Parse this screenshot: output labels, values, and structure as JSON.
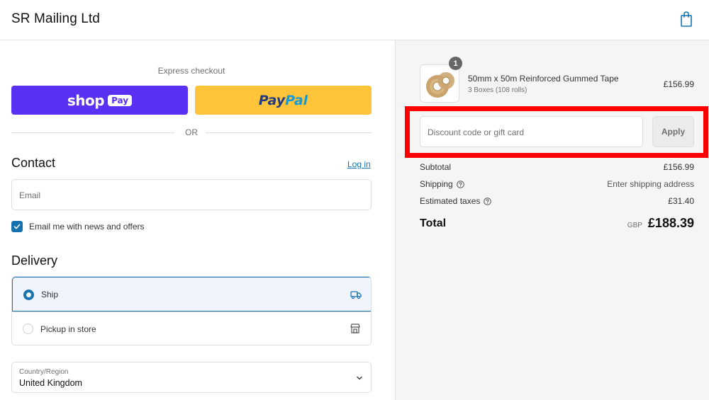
{
  "header": {
    "brand": "SR Mailing Ltd",
    "cart_icon": "shopping-bag-icon"
  },
  "express": {
    "label": "Express checkout",
    "shop_pay": {
      "word": "shop",
      "badge": "Pay",
      "color": "#5a31f4"
    },
    "paypal": {
      "part1": "Pay",
      "part2": "Pal",
      "color": "#ffc439"
    },
    "or_text": "OR"
  },
  "contact": {
    "title": "Contact",
    "login_label": "Log in",
    "email_placeholder": "Email",
    "news_checkbox_label": "Email me with news and offers",
    "news_checked": true
  },
  "delivery": {
    "title": "Delivery",
    "options": [
      {
        "label": "Ship",
        "selected": true,
        "icon": "truck-icon"
      },
      {
        "label": "Pickup in store",
        "selected": false,
        "icon": "store-icon"
      }
    ],
    "country_label": "Country/Region",
    "country_value": "United Kingdom"
  },
  "order": {
    "item": {
      "name": "50mm x 50m Reinforced Gummed Tape",
      "variant": "3 Boxes (108 rolls)",
      "price": "£156.99",
      "quantity": "1"
    },
    "discount": {
      "placeholder": "Discount code or gift card",
      "apply_label": "Apply"
    },
    "summary": {
      "subtotal_label": "Subtotal",
      "subtotal_value": "£156.99",
      "shipping_label": "Shipping",
      "shipping_value": "Enter shipping address",
      "taxes_label": "Estimated taxes",
      "taxes_value": "£31.40",
      "total_label": "Total",
      "currency": "GBP",
      "total_value": "£188.39"
    }
  },
  "colors": {
    "accent": "#1773b0",
    "highlight": "#ff0000",
    "sidebar_bg": "#f5f5f5"
  }
}
